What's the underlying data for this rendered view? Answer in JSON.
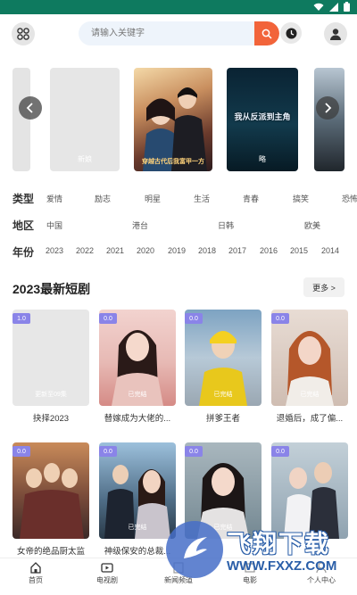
{
  "search": {
    "placeholder": "请输入关键字"
  },
  "carousel": {
    "slides": [
      {
        "caption": ""
      },
      {
        "caption": "新娘"
      },
      {
        "caption": "穿越古代后我富甲一方",
        "title_art": "穿越古代后富甲一方"
      },
      {
        "caption": "略",
        "title_art": "我从反派到主角"
      },
      {
        "caption": ""
      }
    ]
  },
  "filters": {
    "type": {
      "label": "类型",
      "items": [
        "爱情",
        "励志",
        "明星",
        "生活",
        "青春",
        "搞笑",
        "恐怖"
      ]
    },
    "region": {
      "label": "地区",
      "items": [
        "中国",
        "港台",
        "日韩",
        "欧美"
      ]
    },
    "year": {
      "label": "年份",
      "items": [
        "2023",
        "2022",
        "2021",
        "2020",
        "2019",
        "2018",
        "2017",
        "2016",
        "2015",
        "2014"
      ]
    }
  },
  "section": {
    "title": "2023最新短剧",
    "more": "更多 >"
  },
  "cards": [
    {
      "badge": "1.0",
      "status": "更新至09集",
      "title": "抉择2023"
    },
    {
      "badge": "0.0",
      "status": "已完结",
      "title": "替嫁成为大佬的..."
    },
    {
      "badge": "0.0",
      "status": "已完结",
      "title": "拼爹王者"
    },
    {
      "badge": "0.0",
      "status": "已完结",
      "title": "退婚后，成了偏..."
    },
    {
      "badge": "0.0",
      "status": "",
      "title": "女帝的绝品厨太监"
    },
    {
      "badge": "0.0",
      "status": "已完结",
      "title": "神级保安的总裁..."
    },
    {
      "badge": "0.0",
      "status": "已完结",
      "title": ""
    },
    {
      "badge": "0.0",
      "status": "",
      "title": ""
    }
  ],
  "nav": {
    "items": [
      "首页",
      "电视剧",
      "新闻频道",
      "电影",
      "个人中心"
    ]
  },
  "watermark": {
    "brand": "飞翔下载",
    "url": "WWW.FXXZ.COM"
  },
  "colors": {
    "statusbar": "#0e7a5f",
    "accent": "#f2643a",
    "badge": "#8a84e8"
  }
}
